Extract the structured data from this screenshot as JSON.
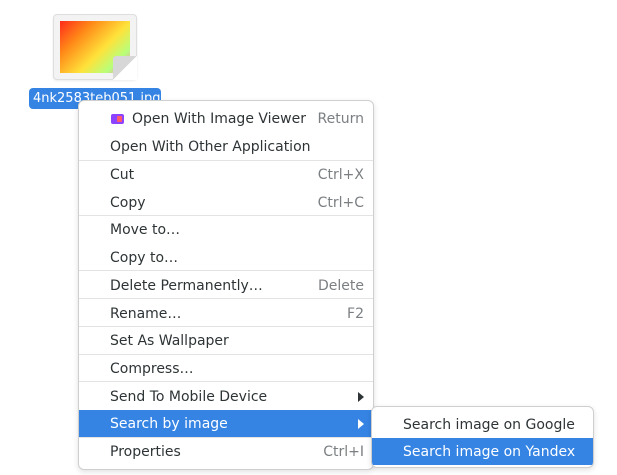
{
  "file": {
    "name": "4nk2583teb051.jpg"
  },
  "menu": {
    "items": [
      {
        "label": "Open With Image Viewer",
        "accel": "Return"
      },
      {
        "label": "Open With Other Application",
        "accel": ""
      },
      {
        "label": "Cut",
        "accel": "Ctrl+X"
      },
      {
        "label": "Copy",
        "accel": "Ctrl+C"
      },
      {
        "label": "Move to…",
        "accel": ""
      },
      {
        "label": "Copy to…",
        "accel": ""
      },
      {
        "label": "Delete Permanently…",
        "accel": "Delete"
      },
      {
        "label": "Rename…",
        "accel": "F2"
      },
      {
        "label": "Set As Wallpaper",
        "accel": ""
      },
      {
        "label": "Compress…",
        "accel": ""
      },
      {
        "label": "Send To Mobile Device",
        "accel": ""
      },
      {
        "label": "Search by image",
        "accel": ""
      },
      {
        "label": "Properties",
        "accel": "Ctrl+I"
      }
    ]
  },
  "submenu": {
    "items": [
      {
        "label": "Search image on Google"
      },
      {
        "label": "Search image on Yandex"
      }
    ]
  },
  "colors": {
    "selection": "#3584e4",
    "text": "#2e3436"
  }
}
